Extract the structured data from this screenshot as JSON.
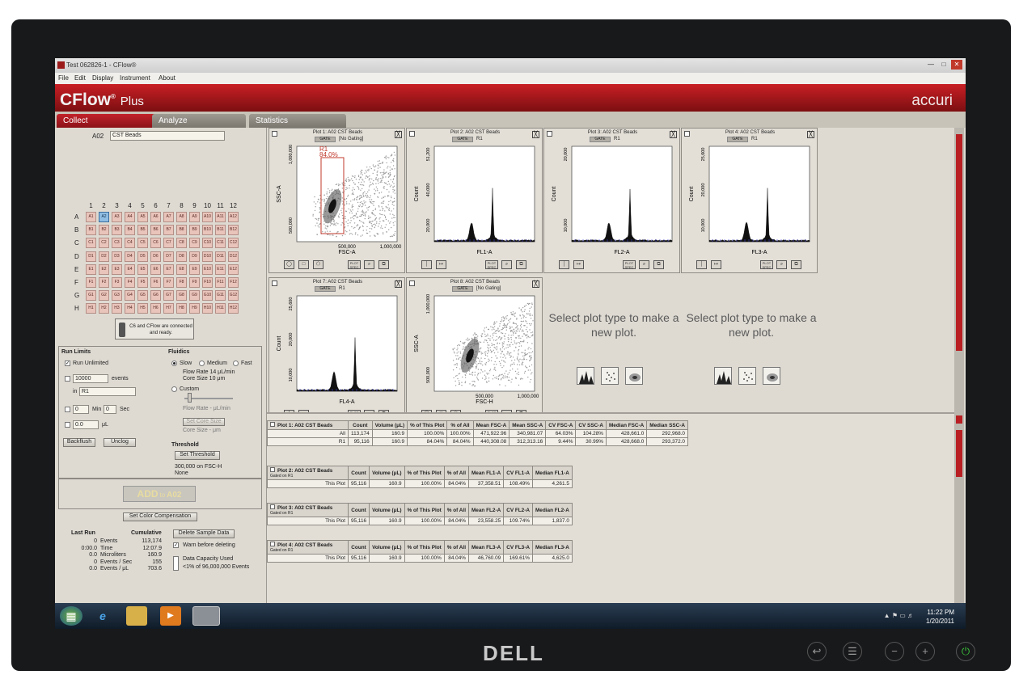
{
  "window": {
    "title": "Test 062826-1 - CFlow®",
    "menu": [
      "File",
      "Edit",
      "Display",
      "Instrument",
      "About"
    ]
  },
  "banner": {
    "brand": "CFlow",
    "brand_suffix": "®",
    "brand_plus": "Plus",
    "company": "accuri"
  },
  "tabs": [
    "Collect",
    "Analyze",
    "Statistics"
  ],
  "sample": {
    "well": "A02",
    "name": "CST Beads"
  },
  "plate": {
    "columns": [
      "1",
      "2",
      "3",
      "4",
      "5",
      "6",
      "7",
      "8",
      "9",
      "10",
      "11",
      "12"
    ],
    "rows": [
      "A",
      "B",
      "C",
      "D",
      "E",
      "F",
      "G",
      "H"
    ],
    "selected": "A2"
  },
  "connection_status": "C6 and CFlow are connected and ready.",
  "run_limits": {
    "title": "Run Limits",
    "run_unlimited": "Run Unlimited",
    "events_value": "10000",
    "events_label": "events",
    "in_label": "in",
    "gate_value": "R1",
    "min_value": "0",
    "min_label": "Min",
    "sec_value": "0",
    "sec_label": "Sec",
    "ul_value": "0.0",
    "ul_label": "μL",
    "backflush": "Backflush",
    "unclog": "Unclog"
  },
  "fluidics": {
    "title": "Fluidics",
    "slow": "Slow",
    "medium": "Medium",
    "fast": "Fast",
    "flow_rate": "Flow Rate  14 μL/min",
    "core_size": "Core Size  10 μm",
    "custom": "Custom",
    "flow_rate_custom": "Flow Rate - μL/min",
    "set_core_size": "Set Core Size",
    "core_size_custom": "Core Size - μm"
  },
  "threshold": {
    "title": "Threshold",
    "button": "Set Threshold",
    "value": "300,000 on FSC-H",
    "secondary": "None"
  },
  "add_button": {
    "add": "ADD",
    "to": "to",
    "well": "A02"
  },
  "set_color_comp": "Set Color Compensation",
  "last_run": {
    "title": "Last Run",
    "cumulative": "Cumulative",
    "delete_button": "Delete Sample Data",
    "warn": "Warn before deleting",
    "rows": [
      {
        "last": "0",
        "label": "Events",
        "cum": "113,174"
      },
      {
        "last": "0:00.0",
        "label": "Time",
        "cum": "12:07.9"
      },
      {
        "last": "0.0",
        "label": "Microliters",
        "cum": "160.9"
      },
      {
        "last": "0",
        "label": "Events / Sec",
        "cum": "155"
      },
      {
        "last": "0.0",
        "label": "Events / μL",
        "cum": "703.6"
      }
    ],
    "capacity_title": "Data Capacity Used",
    "capacity_value": "<1% of 96,000,000 Events"
  },
  "plots": [
    {
      "title": "Plot 1: A02 CST Beads",
      "gate": "GATE",
      "gate_info": "[No Gating]",
      "type": "density",
      "xlabel": "FSC-A",
      "ylabel": "SSC-A",
      "xticks": [
        "500,000",
        "1,000,000"
      ],
      "yticks": [
        "500,000",
        "1,000,000"
      ],
      "region": {
        "name": "R1",
        "pct": "84.0%"
      }
    },
    {
      "title": "Plot 2: A02 CST Beads",
      "gate": "GATE",
      "gate_info": "R1",
      "type": "histogram",
      "xlabel": "FL1-A",
      "ylabel": "Count",
      "yticks": [
        "20,000",
        "40,000",
        "51,200"
      ]
    },
    {
      "title": "Plot 3: A02 CST Beads",
      "gate": "GATE",
      "gate_info": "R1",
      "type": "histogram",
      "xlabel": "FL2-A",
      "ylabel": "Count",
      "yticks": [
        "10,000",
        "20,000"
      ]
    },
    {
      "title": "Plot 4: A02 CST Beads",
      "gate": "GATE",
      "gate_info": "R1",
      "type": "histogram",
      "xlabel": "FL3-A",
      "ylabel": "Count",
      "yticks": [
        "10,000",
        "20,000",
        "25,600"
      ]
    },
    {
      "title": "Plot 7: A02 CST Beads",
      "gate": "GATE",
      "gate_info": "R1",
      "type": "histogram",
      "xlabel": "FL4-A",
      "ylabel": "Count",
      "yticks": [
        "10,000",
        "20,000",
        "25,600"
      ]
    },
    {
      "title": "Plot 8: A02 CST Beads",
      "gate": "GATE",
      "gate_info": "[No Gating]",
      "type": "density",
      "xlabel": "FSC-H",
      "ylabel": "SSC-A",
      "xticks": [
        "500,000",
        "1,000,000"
      ],
      "yticks": [
        "500,000",
        "1,000,000"
      ]
    }
  ],
  "plot_toolbar": {
    "spec": "PLOT SPEC"
  },
  "new_plot_prompt": "Select plot type to make a new plot.",
  "stats_tables": [
    {
      "title": "Plot 1: A02 CST Beads",
      "subtitle": "",
      "headers": [
        "Count",
        "Volume (μL)",
        "% of This Plot",
        "% of All",
        "Mean FSC-A",
        "Mean SSC-A",
        "CV FSC-A",
        "CV SSC-A",
        "Median FSC-A",
        "Median SSC-A"
      ],
      "rows": [
        {
          "label": "All",
          "cells": [
            "113,174",
            "160.9",
            "100.00%",
            "100.00%",
            "471,922.96",
            "340,981.07",
            "64.03%",
            "104.28%",
            "428,661.0",
            "292,968.0"
          ]
        },
        {
          "label": "R1",
          "cells": [
            "95,116",
            "160.9",
            "84.04%",
            "84.04%",
            "440,308.08",
            "312,313.16",
            "9.44%",
            "30.99%",
            "428,668.0",
            "293,372.0"
          ]
        }
      ]
    },
    {
      "title": "Plot 2: A02 CST Beads",
      "subtitle": "Gated on R1",
      "headers": [
        "Count",
        "Volume (μL)",
        "% of This Plot",
        "% of All",
        "Mean FL1-A",
        "CV FL1-A",
        "Median FL1-A"
      ],
      "rows": [
        {
          "label": "This Plot",
          "cells": [
            "95,116",
            "160.9",
            "100.00%",
            "84.04%",
            "37,358.51",
            "108.49%",
            "4,261.5"
          ]
        }
      ]
    },
    {
      "title": "Plot 3: A02 CST Beads",
      "subtitle": "Gated on R1",
      "headers": [
        "Count",
        "Volume (μL)",
        "% of This Plot",
        "% of All",
        "Mean FL2-A",
        "CV FL2-A",
        "Median FL2-A"
      ],
      "rows": [
        {
          "label": "This Plot",
          "cells": [
            "95,116",
            "160.9",
            "100.00%",
            "84.04%",
            "23,558.25",
            "109.74%",
            "1,837.0"
          ]
        }
      ]
    },
    {
      "title": "Plot 4: A02 CST Beads",
      "subtitle": "Gated on R1",
      "headers": [
        "Count",
        "Volume (μL)",
        "% of This Plot",
        "% of All",
        "Mean FL3-A",
        "CV FL3-A",
        "Median FL3-A"
      ],
      "rows": [
        {
          "label": "This Plot",
          "cells": [
            "95,116",
            "160.9",
            "100.00%",
            "84.04%",
            "46,760.09",
            "169.61%",
            "4,625.0"
          ]
        }
      ]
    }
  ],
  "taskbar": {
    "time": "11:22 PM",
    "date": "1/20/2011"
  },
  "monitor_brand": "DELL",
  "colors": {
    "brand_red": "#b81e22",
    "well": "#e9c4ba",
    "well_selected": "#8fbde3"
  }
}
